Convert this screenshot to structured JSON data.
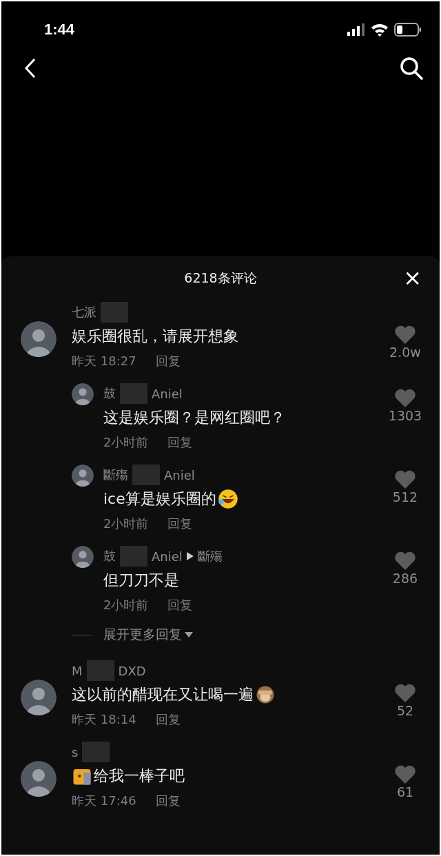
{
  "status_bar": {
    "time": "1:44"
  },
  "panel": {
    "title": "6218条评论",
    "close": "×"
  },
  "comments": [
    {
      "kind": "plain",
      "name_parts": [
        "七派"
      ],
      "text": "娱乐圈很乱，请展开想象",
      "time": "昨天 18:27",
      "reply": "回复",
      "likes": "2.0w",
      "replies": [
        {
          "kind": "plain",
          "name_parts": [
            "鼓",
            "Aniel"
          ],
          "text": "这是娱乐圈？是网红圈吧？",
          "time": "2小时前",
          "reply": "回复",
          "likes": "1303"
        },
        {
          "kind": "laughing",
          "name_parts": [
            "斷殤",
            "Aniel"
          ],
          "text": "ice算是娱乐圈的",
          "time": "2小时前",
          "reply": "回复",
          "likes": "512"
        },
        {
          "kind": "plain",
          "name_parts": [
            "鼓",
            "Aniel"
          ],
          "reply_to": "斷殤",
          "text": "但刀刀不是",
          "time": "2小时前",
          "reply": "回复",
          "likes": "286"
        }
      ],
      "more": "展开更多回复"
    },
    {
      "kind": "monkey",
      "name_parts": [
        "M",
        "DXD"
      ],
      "text": "这以前的醋现在又让喝一遍",
      "time": "昨天 18:14",
      "reply": "回复",
      "likes": "52"
    },
    {
      "kind": "sticker",
      "name_parts": [
        "s"
      ],
      "text": "给我一棒子吧",
      "time": "昨天 17:46",
      "reply": "回复",
      "likes": "61"
    }
  ]
}
